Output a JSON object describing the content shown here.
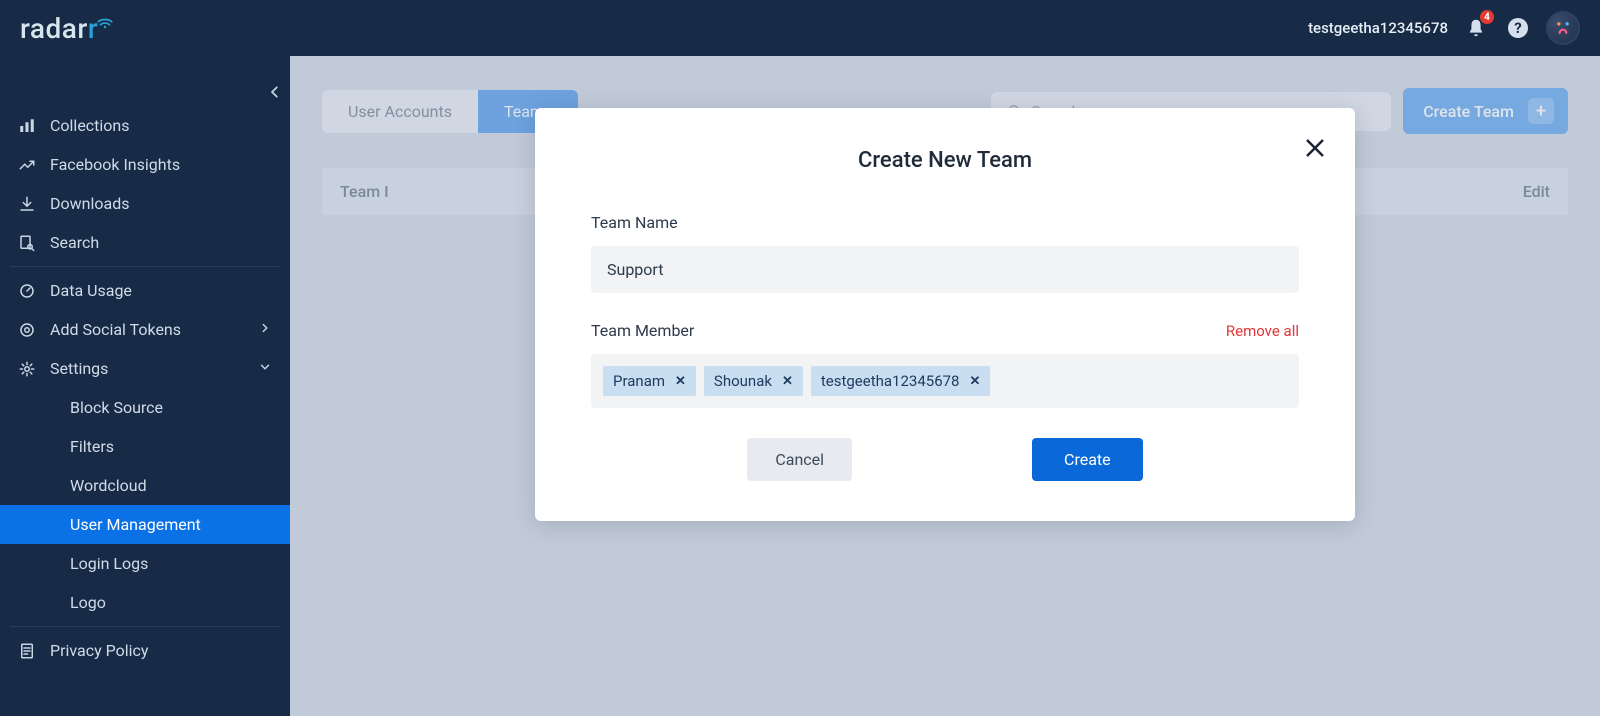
{
  "brand": {
    "name_part1": "radar",
    "name_part2": "r"
  },
  "header": {
    "username": "testgeetha12345678",
    "notification_count": "4"
  },
  "sidebar": {
    "items_top": [
      {
        "label": "Collections",
        "icon": "bars"
      },
      {
        "label": "Facebook Insights",
        "icon": "trend"
      },
      {
        "label": "Downloads",
        "icon": "download"
      },
      {
        "label": "Search",
        "icon": "search-doc"
      }
    ],
    "items_mid": [
      {
        "label": "Data Usage",
        "icon": "gauge"
      },
      {
        "label": "Add Social Tokens",
        "icon": "target",
        "chev": "right"
      },
      {
        "label": "Settings",
        "icon": "gear",
        "chev": "down"
      }
    ],
    "settings_sub": [
      {
        "label": "Block Source"
      },
      {
        "label": "Filters"
      },
      {
        "label": "Wordcloud"
      },
      {
        "label": "User Management",
        "active": true
      },
      {
        "label": "Login Logs"
      },
      {
        "label": "Logo"
      }
    ],
    "items_bottom": [
      {
        "label": "Privacy Policy",
        "icon": "doc"
      }
    ]
  },
  "main": {
    "tabs": [
      {
        "label": "User Accounts"
      },
      {
        "label": "Teams",
        "active": true
      }
    ],
    "search_placeholder": "Search",
    "create_team_label": "Create Team",
    "table_headers": {
      "team": "Team I",
      "edit": "Edit"
    }
  },
  "modal": {
    "title": "Create New Team",
    "team_name_label": "Team Name",
    "team_name_value": "Support",
    "team_member_label": "Team Member",
    "remove_all_label": "Remove all",
    "members": [
      {
        "name": "Pranam"
      },
      {
        "name": "Shounak"
      },
      {
        "name": "testgeetha12345678"
      }
    ],
    "cancel_label": "Cancel",
    "create_label": "Create"
  }
}
